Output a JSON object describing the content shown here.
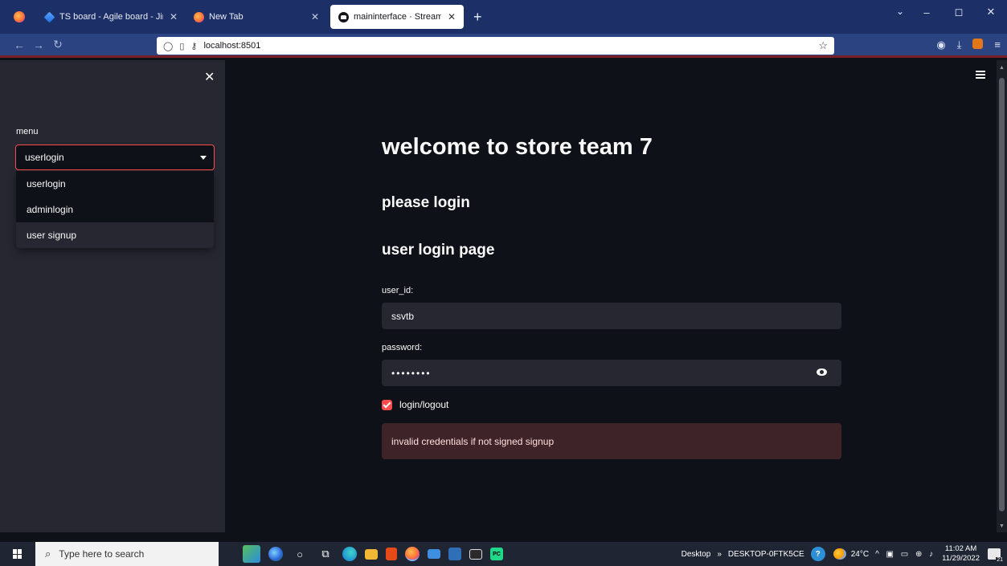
{
  "browser": {
    "tabs": [
      {
        "title": "TS board - Agile board - Jira",
        "icon": "jira-icon"
      },
      {
        "title": "New Tab",
        "icon": "firefox-icon"
      },
      {
        "title": "maininterface · Streamlit",
        "icon": "streamlit-icon",
        "active": true
      }
    ],
    "new_tab": "+",
    "url": "localhost:8501",
    "window_controls": {
      "minimize": "–",
      "maximize": "◻",
      "close": "✕"
    }
  },
  "sidebar": {
    "close": "✕",
    "menu_label": "menu",
    "selected": "userlogin",
    "options": [
      "userlogin",
      "adminlogin",
      "user signup"
    ]
  },
  "main": {
    "title": "welcome to store team 7",
    "subtitle": "please login",
    "section": "user login page",
    "user_id_label": "user_id:",
    "user_id_value": "ssvtb",
    "password_label": "password:",
    "password_value": "••••••••",
    "checkbox_label": "login/logout",
    "checkbox_checked": true,
    "alert": "invalid credentials if not signed signup",
    "colors": {
      "primary": "#ff4b4b",
      "background": "#0e1117",
      "sidebar": "#262730",
      "error_bg": "#3e2428"
    }
  },
  "taskbar": {
    "search_placeholder": "Type here to search",
    "desktop": "Desktop",
    "overflow": "»",
    "computer": "DESKTOP-0FTK5CE",
    "temperature": "24°C",
    "time": "11:02 AM",
    "date": "11/29/2022",
    "notifications": "21"
  }
}
